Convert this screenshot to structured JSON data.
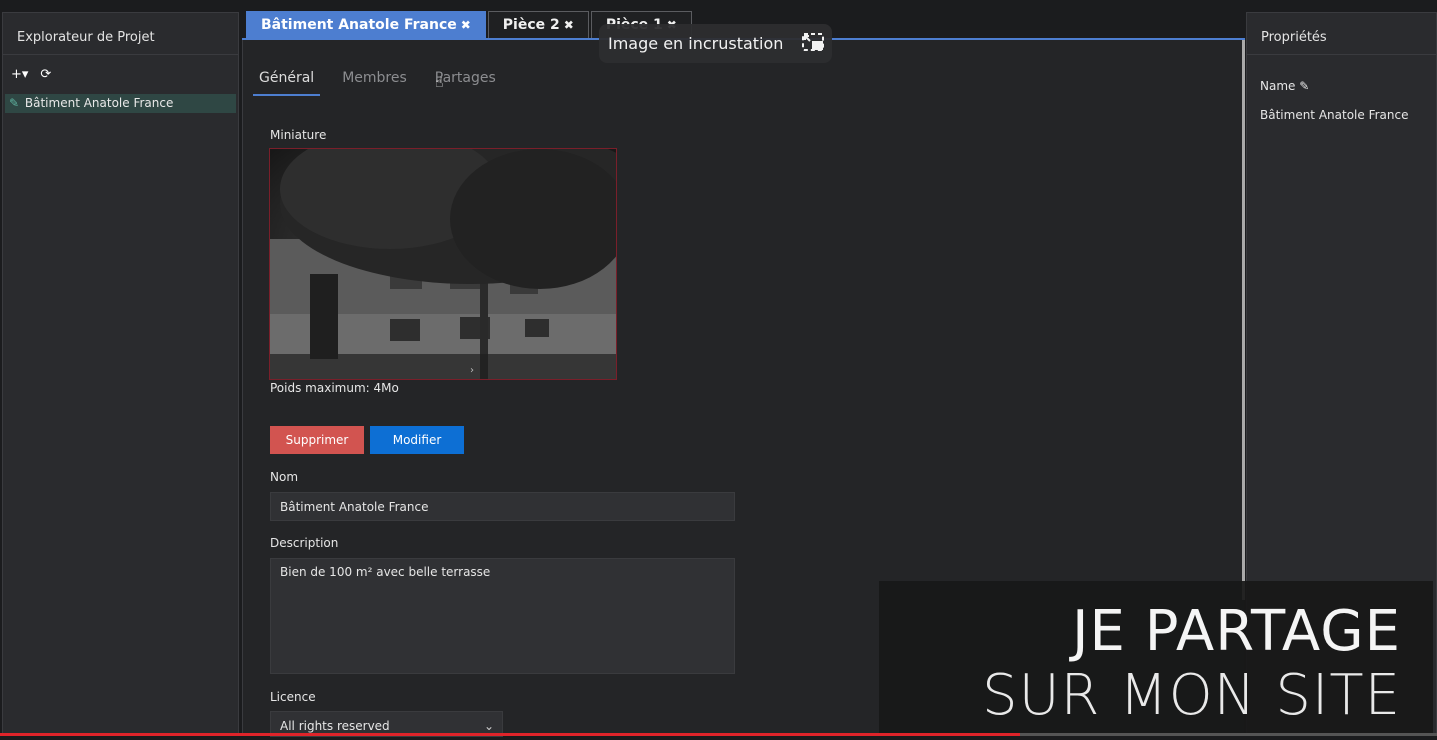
{
  "left_panel": {
    "title": "Explorateur de Projet",
    "toolbar": {
      "add_icon": "plus-dropdown-icon",
      "refresh_icon": "refresh-icon"
    },
    "tree": [
      {
        "label": "Bâtiment Anatole France",
        "icon": "pencil-icon"
      }
    ]
  },
  "tabs": [
    {
      "label": "Bâtiment Anatole France",
      "active": true
    },
    {
      "label": "Pièce 2",
      "active": false
    },
    {
      "label": "Pièce 1",
      "active": false
    }
  ],
  "pip": {
    "label": "Image en incrustation",
    "icon": "picture-in-picture-exit-icon"
  },
  "subtabs": [
    {
      "label": "Général",
      "active": true
    },
    {
      "label": "Membres",
      "active": false
    },
    {
      "label": "Partages",
      "active": false
    }
  ],
  "form": {
    "thumbnail_label": "Miniature",
    "max_weight": "Poids maximum: 4Mo",
    "delete_label": "Supprimer",
    "modify_label": "Modifier",
    "name_label": "Nom",
    "name_value": "Bâtiment Anatole France",
    "description_label": "Description",
    "description_value": "Bien de 100 m² avec belle terrasse",
    "licence_label": "Licence",
    "licence_value": "All rights reserved"
  },
  "right_panel": {
    "title": "Propriétés",
    "name_label": "Name",
    "name_value": "Bâtiment Anatole France"
  },
  "overlay": {
    "line1": "JE PARTAGE",
    "line2": "SUR MON SITE"
  },
  "colors": {
    "accent": "#4d7ed0",
    "delete": "#d25450",
    "modify": "#0d6fd4",
    "progress": "#e0242a"
  }
}
